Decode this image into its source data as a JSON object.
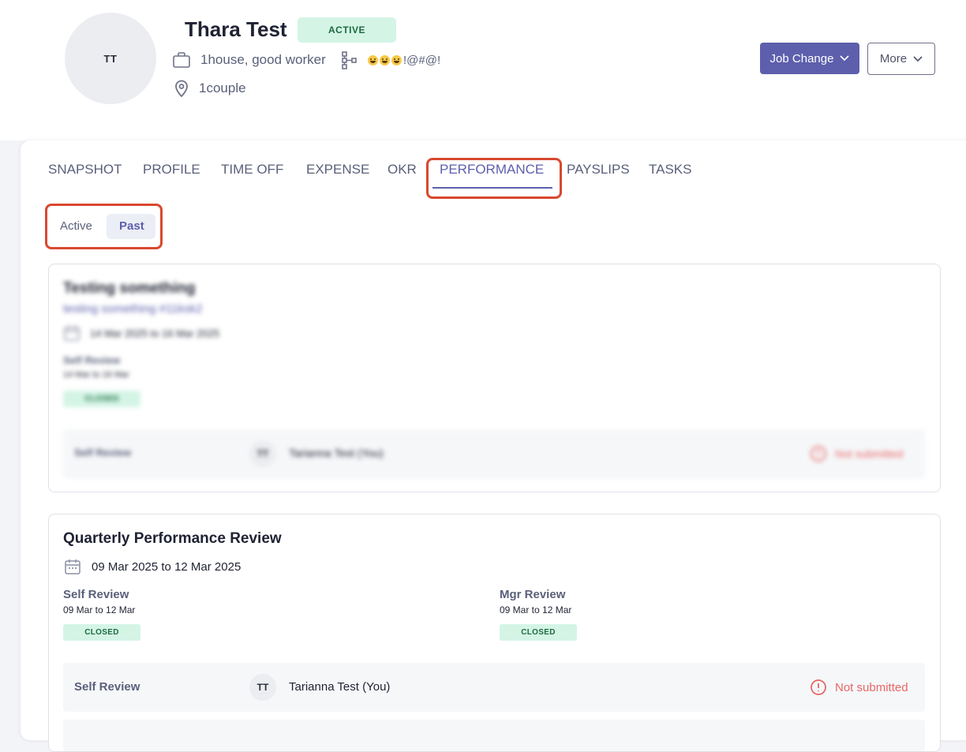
{
  "employee": {
    "initials": "TT",
    "name": "Thara Test",
    "status": "ACTIVE",
    "job_title": "1house, good worker",
    "department": "😀😀😀!@#@!",
    "location": "1couple"
  },
  "actions": {
    "primary_label": "Job Change",
    "secondary_label": "More"
  },
  "tabs": [
    {
      "label": "SNAPSHOT",
      "active": false
    },
    {
      "label": "PROFILE",
      "active": false
    },
    {
      "label": "TIME OFF",
      "active": false
    },
    {
      "label": "EXPENSE",
      "active": false
    },
    {
      "label": "OKR",
      "active": false
    },
    {
      "label": "PERFORMANCE",
      "active": true
    },
    {
      "label": "PAYSLIPS",
      "active": false
    },
    {
      "label": "TASKS",
      "active": false
    }
  ],
  "cycle_filter": {
    "options": [
      "Active",
      "Past"
    ],
    "selected": "Past"
  },
  "reviews": [
    {
      "title": "Testing something",
      "subtitle": "testing something #11ksk2",
      "dates": "14 Mar 2025 to 16 Mar 2025",
      "phases": [
        {
          "title": "Self Review",
          "range": "14 Mar to 16 Mar",
          "status": "CLOSED"
        }
      ],
      "rows": [
        {
          "label": "Self Review",
          "initials": "TT",
          "reviewer": "Tarianna Test (You)",
          "status": "Not submitted"
        }
      ]
    },
    {
      "title": "Quarterly Performance Review",
      "dates": "09 Mar 2025 to 12 Mar 2025",
      "phases": [
        {
          "title": "Self Review",
          "range": "09 Mar to 12 Mar",
          "status": "CLOSED"
        },
        {
          "title": "Mgr Review",
          "range": "09 Mar to 12 Mar",
          "status": "CLOSED"
        }
      ],
      "rows": [
        {
          "label": "Self Review",
          "initials": "TT",
          "reviewer": "Tarianna Test (You)",
          "status": "Not submitted"
        }
      ]
    }
  ],
  "colors": {
    "accent": "#5d5fad",
    "highlight": "#d9482f",
    "closed_bg": "#d4f4e6",
    "error": "#e76767"
  }
}
